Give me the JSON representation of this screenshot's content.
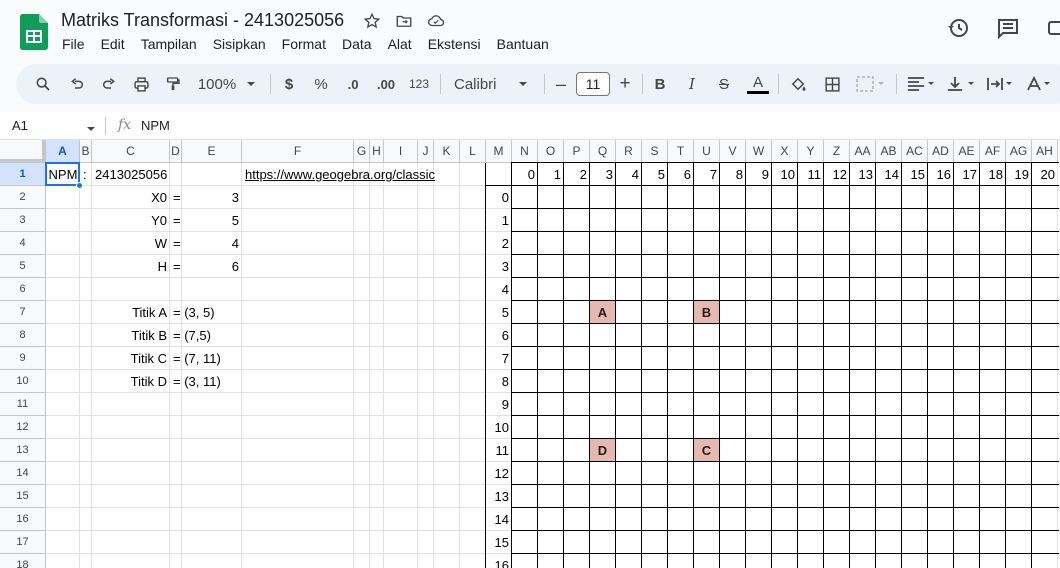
{
  "doc": {
    "title": "Matriks Transformasi - 2413025056",
    "menu": [
      "File",
      "Edit",
      "Tampilan",
      "Sisipkan",
      "Format",
      "Data",
      "Alat",
      "Ekstensi",
      "Bantuan"
    ]
  },
  "toolbar": {
    "zoom": "100%",
    "currency": "$",
    "percent": "%",
    "dec_less": ".0",
    "dec_more": ".00",
    "number_format": "123",
    "font": "Calibri",
    "font_size": "11",
    "minus": "–",
    "plus": "+",
    "bold": "B",
    "italic": "I",
    "strike": "S",
    "text_color": "A",
    "text_color_swatch": "#000000"
  },
  "formula_bar": {
    "name_box": "A1",
    "fx": "fx",
    "content": "NPM"
  },
  "columns": [
    "A",
    "B",
    "C",
    "D",
    "E",
    "F",
    "G",
    "H",
    "I",
    "J",
    "K",
    "L",
    "M",
    "N",
    "O",
    "P",
    "Q",
    "R",
    "S",
    "T",
    "U",
    "V",
    "W",
    "X",
    "Y",
    "Z",
    "AA",
    "AB",
    "AC",
    "AD",
    "AE",
    "AF",
    "AG",
    "AH"
  ],
  "rows": [
    "1",
    "2",
    "3",
    "4",
    "5",
    "6",
    "7",
    "8",
    "9",
    "10",
    "11",
    "12",
    "13",
    "14",
    "15",
    "16",
    "17",
    "18"
  ],
  "cells": {
    "A1": "NPM",
    "B1": ":",
    "C1": "2413025056",
    "F1": "https://www.geogebra.org/classic",
    "C2": "X0",
    "D2": "=",
    "E2": "3",
    "C3": "Y0",
    "D3": "=",
    "E3": "5",
    "C4": "W",
    "D4": "=",
    "E4": "4",
    "C5": "H",
    "D5": "=",
    "E5": "6",
    "C7": "Titik A",
    "D7": "= (3, 5)",
    "C8": "Titik B",
    "D8": "= (7,5)",
    "C9": "Titik C",
    "D9": "= (7, 11)",
    "C10": "Titik D",
    "D10": "= (3, 11)"
  },
  "coordinate_grid": {
    "x_labels": [
      "0",
      "1",
      "2",
      "3",
      "4",
      "5",
      "6",
      "7",
      "8",
      "9",
      "10",
      "11",
      "12",
      "13",
      "14",
      "15",
      "16",
      "17",
      "18",
      "19",
      "20"
    ],
    "y_labels": [
      "0",
      "1",
      "2",
      "3",
      "4",
      "5",
      "6",
      "7",
      "8",
      "9",
      "10",
      "11",
      "12",
      "13",
      "14",
      "15",
      "16"
    ],
    "points": [
      {
        "label": "A",
        "x": 3,
        "y": 5
      },
      {
        "label": "B",
        "x": 7,
        "y": 5
      },
      {
        "label": "D",
        "x": 3,
        "y": 11
      },
      {
        "label": "C",
        "x": 7,
        "y": 11
      }
    ],
    "point_color": "#e6b8af"
  }
}
